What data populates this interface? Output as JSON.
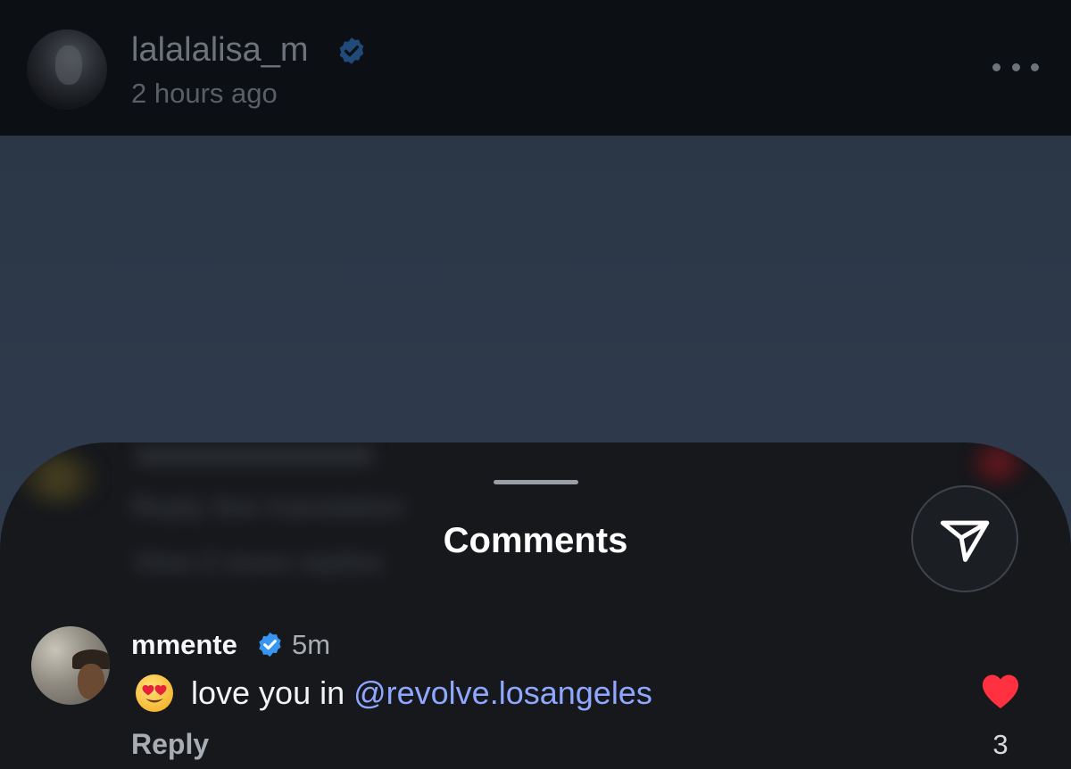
{
  "post": {
    "author": "lalalalisa_m",
    "time": "2 hours ago",
    "verified_icon": "verified-badge-icon",
    "more_icon": "more-dots-icon"
  },
  "sheet": {
    "title": "Comments",
    "blurred_rows": {
      "actions": "Reply   See translation",
      "view_replies": "View 2 more replies"
    },
    "share_icon": "send-icon"
  },
  "comment": {
    "username": "mmente",
    "time": "5m",
    "emoji": "😍",
    "text": "love you in",
    "mention": "@revolve.losangeles",
    "reply_label": "Reply",
    "like_count": "3",
    "like_color": "#ff3040",
    "liked": true
  },
  "colors": {
    "verified": "#3797f0",
    "mention": "#8fa8ff",
    "sheet_bg": "#16181c"
  }
}
